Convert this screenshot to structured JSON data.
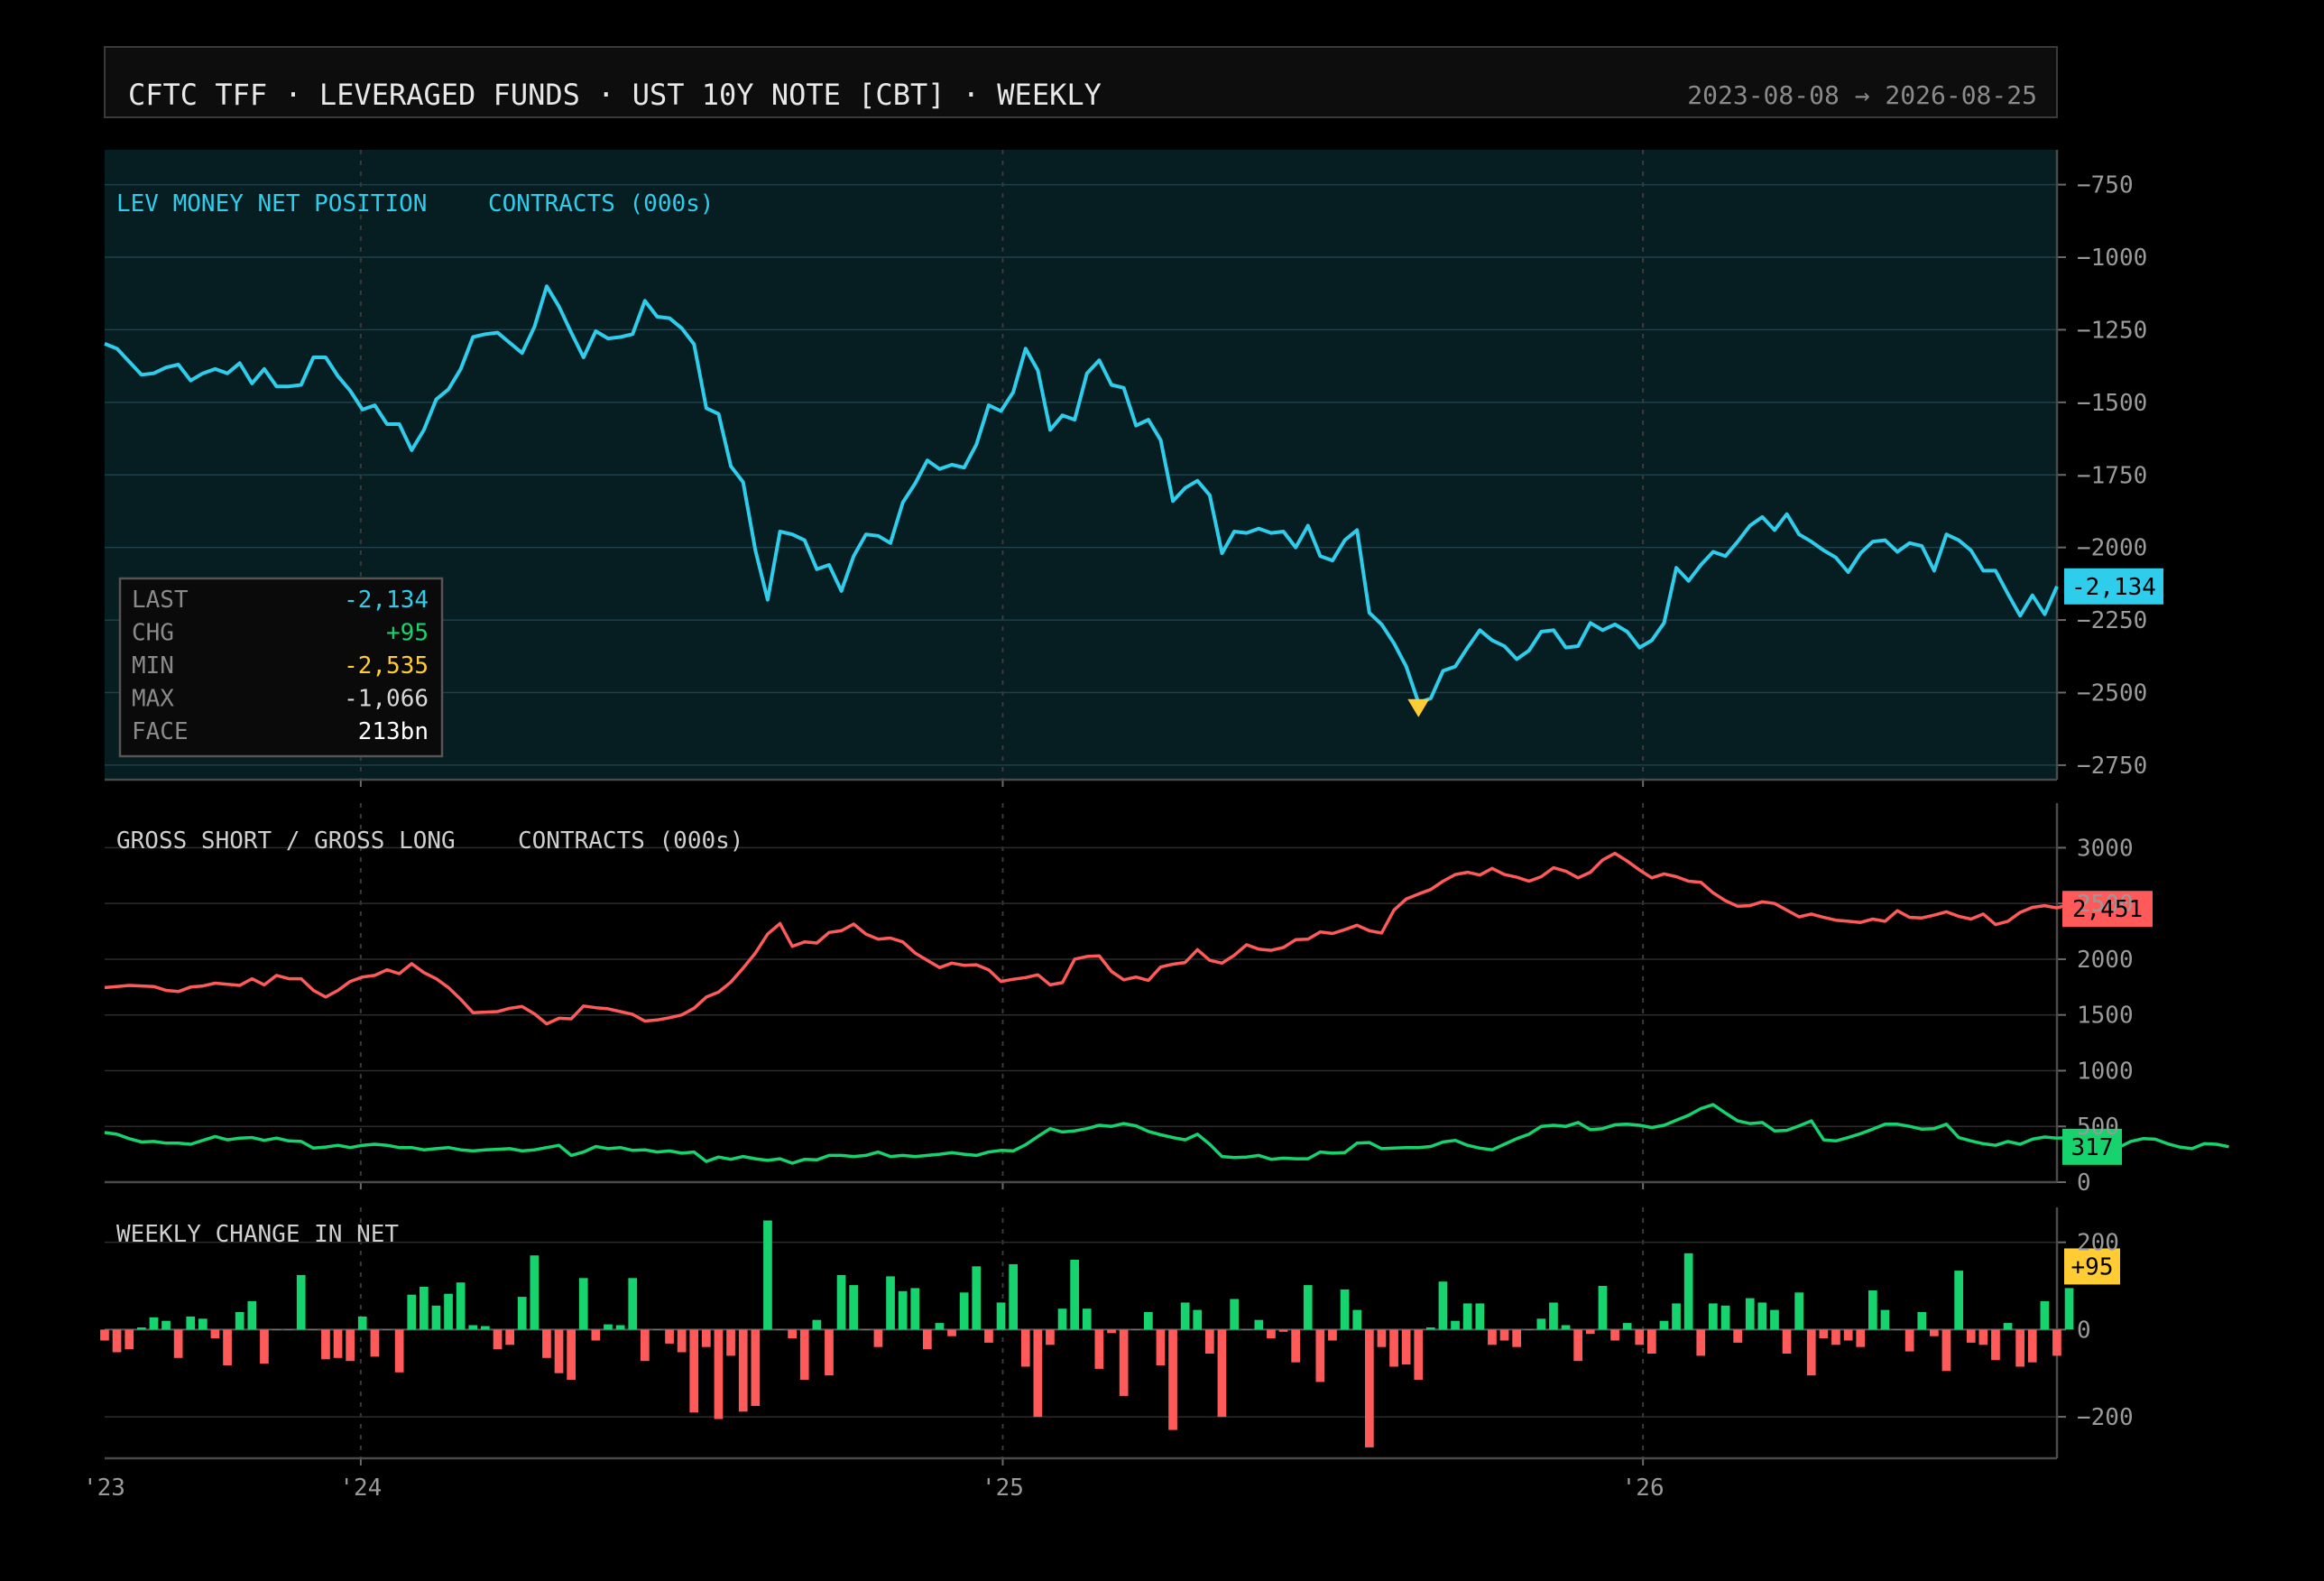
{
  "header": {
    "title": "CFTC TFF  ·  LEVERAGED FUNDS  ·  UST 10Y NOTE [CBT]  ·  WEEKLY",
    "date_range": "2023-08-08 → 2026-08-25"
  },
  "colors": {
    "net": "#2fcdec",
    "short": "#ff5a5a",
    "long": "#16d36e",
    "min_marker": "#ffcc33",
    "neg_bar": "#ff5a5a",
    "pos_bar": "#16d36e"
  },
  "stats": {
    "rows": [
      {
        "key": "LAST",
        "value": "-2,134",
        "color": "#2fcdec"
      },
      {
        "key": "CHG",
        "value": "+95",
        "color": "#16d36e"
      },
      {
        "key": "MIN",
        "value": "-2,535",
        "color": "#ffcc33"
      },
      {
        "key": "MAX",
        "value": "-1,066",
        "color": "#d8d8d8"
      },
      {
        "key": "FACE",
        "value": "213bn",
        "color": "#ffffff"
      }
    ]
  },
  "x_axis": {
    "ticks": [
      {
        "label": "'23",
        "date": "2023-08-08"
      },
      {
        "label": "'24",
        "date": "2024-01-01"
      },
      {
        "label": "'25",
        "date": "2025-01-01"
      },
      {
        "label": "'26",
        "date": "2026-01-01"
      }
    ]
  },
  "chart_data": [
    {
      "type": "line",
      "title": "LEV MONEY NET POSITION",
      "unit": "CONTRACTS (000s)",
      "x_start": "2023-08-08",
      "x_end": "2026-08-25",
      "frequency": "weekly",
      "ylim": [
        -2800,
        -630
      ],
      "yticks": [
        -750,
        -1000,
        -1250,
        -1500,
        -1750,
        -2000,
        -2250,
        -2500,
        -2750
      ],
      "last_badge": "-2,134",
      "series": [
        {
          "name": "LEV MONEY NET POSITION",
          "color": "#2fcdec",
          "values": [
            -1298,
            -1315,
            -1360,
            -1405,
            -1400,
            -1380,
            -1370,
            -1425,
            -1400,
            -1385,
            -1400,
            -1365,
            -1435,
            -1385,
            -1445,
            -1445,
            -1440,
            -1345,
            -1345,
            -1410,
            -1460,
            -1525,
            -1510,
            -1575,
            -1575,
            -1665,
            -1595,
            -1490,
            -1455,
            -1385,
            -1275,
            -1265,
            -1260,
            -1295,
            -1330,
            -1240,
            -1100,
            -1170,
            -1260,
            -1345,
            -1255,
            -1280,
            -1275,
            -1265,
            -1150,
            -1205,
            -1210,
            -1245,
            -1300,
            -1520,
            -1540,
            -1720,
            -1775,
            -2010,
            -2180,
            -1945,
            -1955,
            -1975,
            -2075,
            -2060,
            -2150,
            -2030,
            -1955,
            -1960,
            -1985,
            -1845,
            -1780,
            -1700,
            -1730,
            -1715,
            -1725,
            -1645,
            -1510,
            -1530,
            -1465,
            -1315,
            -1390,
            -1595,
            -1545,
            -1560,
            -1400,
            -1355,
            -1440,
            -1450,
            -1580,
            -1560,
            -1630,
            -1840,
            -1795,
            -1770,
            -1820,
            -2020,
            -1945,
            -1950,
            -1935,
            -1950,
            -1945,
            -2000,
            -1925,
            -2030,
            -2045,
            -1975,
            -1940,
            -2225,
            -2265,
            -2330,
            -2410,
            -2535,
            -2520,
            -2425,
            -2410,
            -2345,
            -2285,
            -2320,
            -2340,
            -2385,
            -2355,
            -2290,
            -2285,
            -2345,
            -2340,
            -2260,
            -2285,
            -2265,
            -2290,
            -2345,
            -2320,
            -2260,
            -2070,
            -2115,
            -2060,
            -2015,
            -2030,
            -1980,
            -1925,
            -1895,
            -1940,
            -1885,
            -1955,
            -1980,
            -2010,
            -2035,
            -2085,
            -2020,
            -1980,
            -1975,
            -2015,
            -1985,
            -1995,
            -2080,
            -1955,
            -1975,
            -2010,
            -2080,
            -2080,
            -2160,
            -2235,
            -2165,
            -2230,
            -2134
          ]
        }
      ]
    },
    {
      "type": "line",
      "title": "GROSS SHORT / GROSS LONG",
      "unit": "CONTRACTS (000s)",
      "x_start": "2023-08-08",
      "x_end": "2026-08-25",
      "frequency": "weekly",
      "ylim": [
        0,
        3400
      ],
      "yticks": [
        0,
        500,
        1000,
        1500,
        2000,
        2500,
        3000
      ],
      "series": [
        {
          "name": "GROSS SHORT",
          "color": "#ff5a5a",
          "badge": "2,451",
          "values": [
            1745,
            1755,
            1765,
            1760,
            1755,
            1720,
            1710,
            1750,
            1760,
            1785,
            1775,
            1765,
            1825,
            1770,
            1855,
            1825,
            1825,
            1720,
            1660,
            1720,
            1800,
            1840,
            1855,
            1905,
            1870,
            1960,
            1880,
            1825,
            1745,
            1640,
            1520,
            1525,
            1530,
            1560,
            1575,
            1510,
            1420,
            1470,
            1465,
            1580,
            1565,
            1555,
            1530,
            1505,
            1445,
            1455,
            1475,
            1500,
            1560,
            1660,
            1705,
            1795,
            1920,
            2055,
            2225,
            2320,
            2115,
            2155,
            2145,
            2240,
            2255,
            2315,
            2225,
            2180,
            2190,
            2155,
            2055,
            1990,
            1925,
            1965,
            1945,
            1950,
            1905,
            1800,
            1820,
            1835,
            1860,
            1770,
            1790,
            2000,
            2025,
            2030,
            1890,
            1815,
            1840,
            1810,
            1930,
            1955,
            1970,
            2085,
            1990,
            1965,
            2035,
            2130,
            2090,
            2080,
            2105,
            2175,
            2180,
            2245,
            2230,
            2265,
            2305,
            2255,
            2235,
            2440,
            2540,
            2585,
            2625,
            2700,
            2760,
            2780,
            2755,
            2815,
            2760,
            2735,
            2700,
            2740,
            2820,
            2790,
            2730,
            2780,
            2890,
            2950,
            2880,
            2800,
            2730,
            2765,
            2740,
            2700,
            2690,
            2595,
            2525,
            2475,
            2480,
            2515,
            2500,
            2440,
            2380,
            2405,
            2375,
            2350,
            2340,
            2330,
            2360,
            2340,
            2435,
            2375,
            2370,
            2395,
            2425,
            2385,
            2360,
            2405,
            2310,
            2340,
            2420,
            2465,
            2480,
            2460,
            2490,
            2510,
            2520,
            2451
          ]
        },
        {
          "name": "GROSS LONG",
          "color": "#16d36e",
          "badge": "317",
          "values": [
            445,
            430,
            390,
            360,
            365,
            350,
            350,
            340,
            375,
            410,
            380,
            395,
            400,
            375,
            395,
            370,
            365,
            305,
            315,
            330,
            310,
            330,
            340,
            330,
            310,
            310,
            290,
            300,
            310,
            290,
            280,
            290,
            295,
            300,
            280,
            290,
            310,
            330,
            240,
            270,
            320,
            300,
            310,
            285,
            290,
            270,
            280,
            260,
            270,
            185,
            225,
            205,
            230,
            210,
            195,
            210,
            170,
            205,
            200,
            240,
            240,
            230,
            240,
            270,
            230,
            240,
            230,
            240,
            250,
            265,
            250,
            240,
            270,
            285,
            280,
            335,
            410,
            480,
            450,
            460,
            480,
            510,
            500,
            525,
            505,
            455,
            425,
            400,
            380,
            430,
            340,
            230,
            220,
            225,
            240,
            205,
            215,
            210,
            210,
            270,
            260,
            265,
            350,
            355,
            300,
            305,
            310,
            310,
            320,
            360,
            375,
            330,
            305,
            290,
            340,
            390,
            430,
            500,
            510,
            500,
            535,
            470,
            480,
            515,
            520,
            510,
            490,
            510,
            555,
            600,
            660,
            695,
            620,
            550,
            525,
            535,
            460,
            465,
            505,
            550,
            380,
            370,
            400,
            435,
            475,
            520,
            520,
            500,
            475,
            480,
            520,
            400,
            370,
            345,
            330,
            365,
            340,
            385,
            405,
            395,
            400,
            385,
            340,
            320,
            310,
            365,
            390,
            385,
            345,
            315,
            300,
            345,
            340,
            317
          ]
        }
      ]
    },
    {
      "type": "bar",
      "title": "WEEKLY CHANGE IN NET",
      "x_start": "2023-08-08",
      "x_end": "2026-08-25",
      "frequency": "weekly",
      "ylim": [
        -295,
        280
      ],
      "yticks": [
        200,
        0,
        -200
      ],
      "last_badge": "+95",
      "values": [
        -25,
        -52,
        -45,
        5,
        28,
        20,
        -65,
        30,
        25,
        -20,
        -82,
        40,
        65,
        -78,
        0,
        0,
        125,
        0,
        -68,
        -65,
        -72,
        30,
        -62,
        0,
        -98,
        80,
        98,
        55,
        82,
        108,
        10,
        8,
        -45,
        -35,
        75,
        170,
        -65,
        -100,
        -115,
        118,
        -25,
        12,
        10,
        118,
        -72,
        0,
        -32,
        -52,
        -190,
        -40,
        -205,
        -60,
        -188,
        -175,
        250,
        0,
        -20,
        -115,
        22,
        -105,
        125,
        102,
        0,
        -40,
        122,
        88,
        95,
        -45,
        15,
        -15,
        85,
        145,
        -30,
        62,
        150,
        -85,
        -200,
        -35,
        48,
        160,
        48,
        -90,
        -8,
        -152,
        0,
        40,
        -82,
        -230,
        62,
        45,
        -55,
        -200,
        70,
        0,
        22,
        -20,
        -5,
        -75,
        102,
        -120,
        -25,
        92,
        45,
        -270,
        -40,
        -85,
        -80,
        -115,
        5,
        110,
        20,
        60,
        60,
        -35,
        -25,
        -40,
        0,
        25,
        62,
        10,
        -72,
        -10,
        100,
        -25,
        15,
        -35,
        -55,
        20,
        60,
        175,
        -60,
        60,
        55,
        -30,
        72,
        62,
        45,
        -55,
        85,
        -105,
        -20,
        -35,
        -25,
        -40,
        90,
        45,
        0,
        -50,
        40,
        -15,
        -95,
        135,
        -30,
        -35,
        -70,
        15,
        -85,
        -75,
        65,
        -60,
        95
      ]
    }
  ]
}
